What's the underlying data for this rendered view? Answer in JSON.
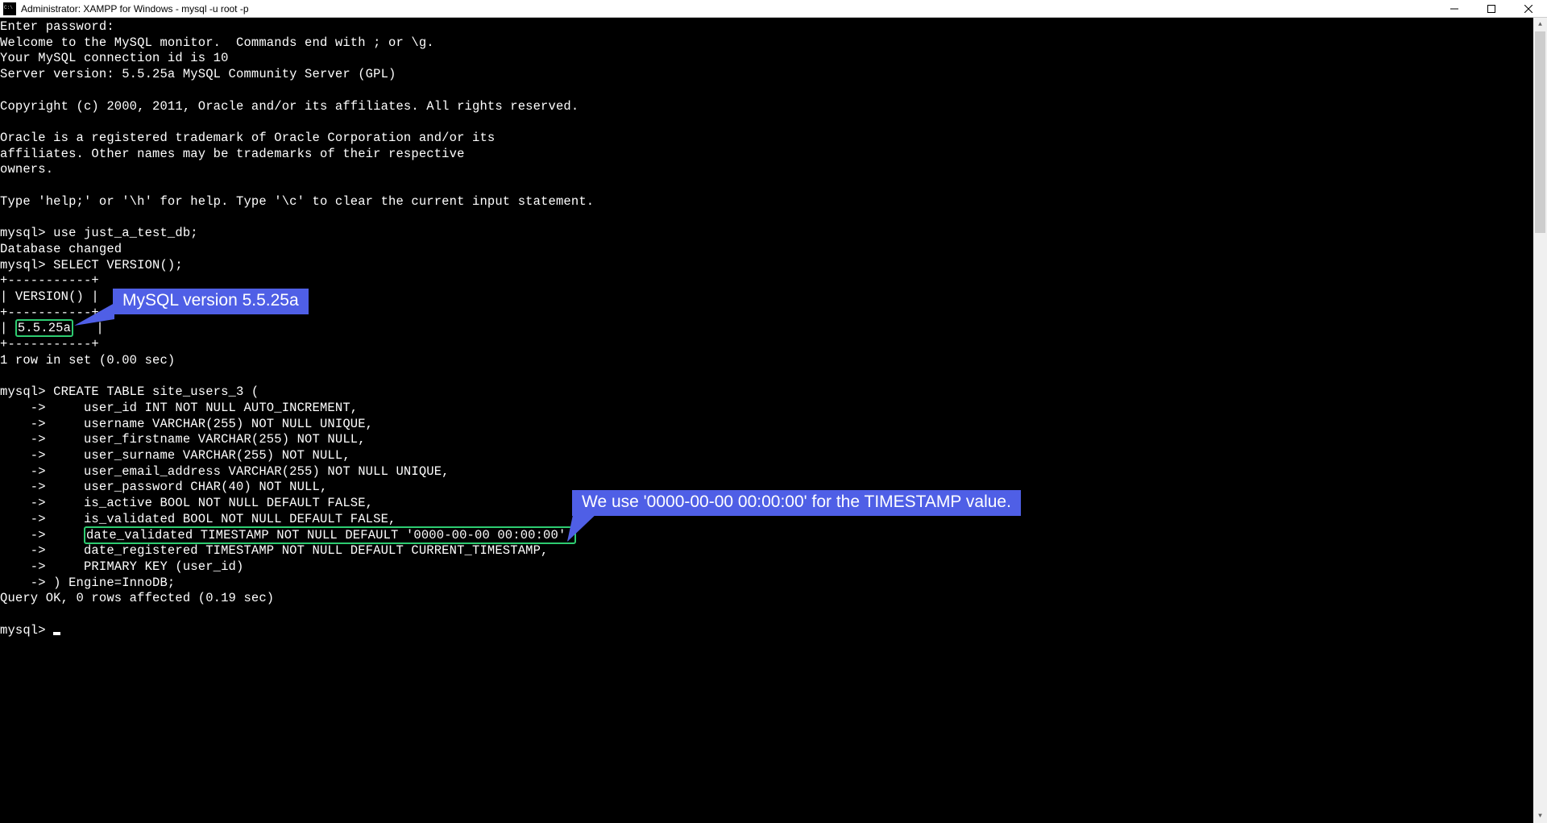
{
  "window": {
    "title": "Administrator:  XAMPP for Windows - mysql  -u root -p"
  },
  "term": {
    "l01": "Enter password:",
    "l02": "Welcome to the MySQL monitor.  Commands end with ; or \\g.",
    "l03": "Your MySQL connection id is 10",
    "l04": "Server version: 5.5.25a MySQL Community Server (GPL)",
    "l05": "",
    "l06": "Copyright (c) 2000, 2011, Oracle and/or its affiliates. All rights reserved.",
    "l07": "",
    "l08": "Oracle is a registered trademark of Oracle Corporation and/or its",
    "l09": "affiliates. Other names may be trademarks of their respective",
    "l10": "owners.",
    "l11": "",
    "l12": "Type 'help;' or '\\h' for help. Type '\\c' to clear the current input statement.",
    "l13": "",
    "l14": "mysql> use just_a_test_db;",
    "l15": "Database changed",
    "l16": "mysql> SELECT VERSION();",
    "l17": "+-----------+",
    "l18": "| VERSION() |",
    "l19": "+-----------+",
    "l20a": "| ",
    "l20b": "5.5.25a",
    "l20c": "   |",
    "l21": "+-----------+",
    "l22": "1 row in set (0.00 sec)",
    "l23": "",
    "l24": "mysql> CREATE TABLE site_users_3 (",
    "l25": "    ->     user_id INT NOT NULL AUTO_INCREMENT,",
    "l26": "    ->     username VARCHAR(255) NOT NULL UNIQUE,",
    "l27": "    ->     user_firstname VARCHAR(255) NOT NULL,",
    "l28": "    ->     user_surname VARCHAR(255) NOT NULL,",
    "l29": "    ->     user_email_address VARCHAR(255) NOT NULL UNIQUE,",
    "l30": "    ->     user_password CHAR(40) NOT NULL,",
    "l31": "    ->     is_active BOOL NOT NULL DEFAULT FALSE,",
    "l32": "    ->     is_validated BOOL NOT NULL DEFAULT FALSE,",
    "l33a": "    ->     ",
    "l33b": "date_validated TIMESTAMP NOT NULL DEFAULT '0000-00-00 00:00:00',",
    "l34": "    ->     date_registered TIMESTAMP NOT NULL DEFAULT CURRENT_TIMESTAMP,",
    "l35": "    ->     PRIMARY KEY (user_id)",
    "l36": "    -> ) Engine=InnoDB;",
    "l37": "Query OK, 0 rows affected (0.19 sec)",
    "l38": "",
    "l39": "mysql> "
  },
  "callouts": {
    "c1": "MySQL version 5.5.25a",
    "c2": "We use '0000-00-00 00:00:00' for the TIMESTAMP value."
  }
}
